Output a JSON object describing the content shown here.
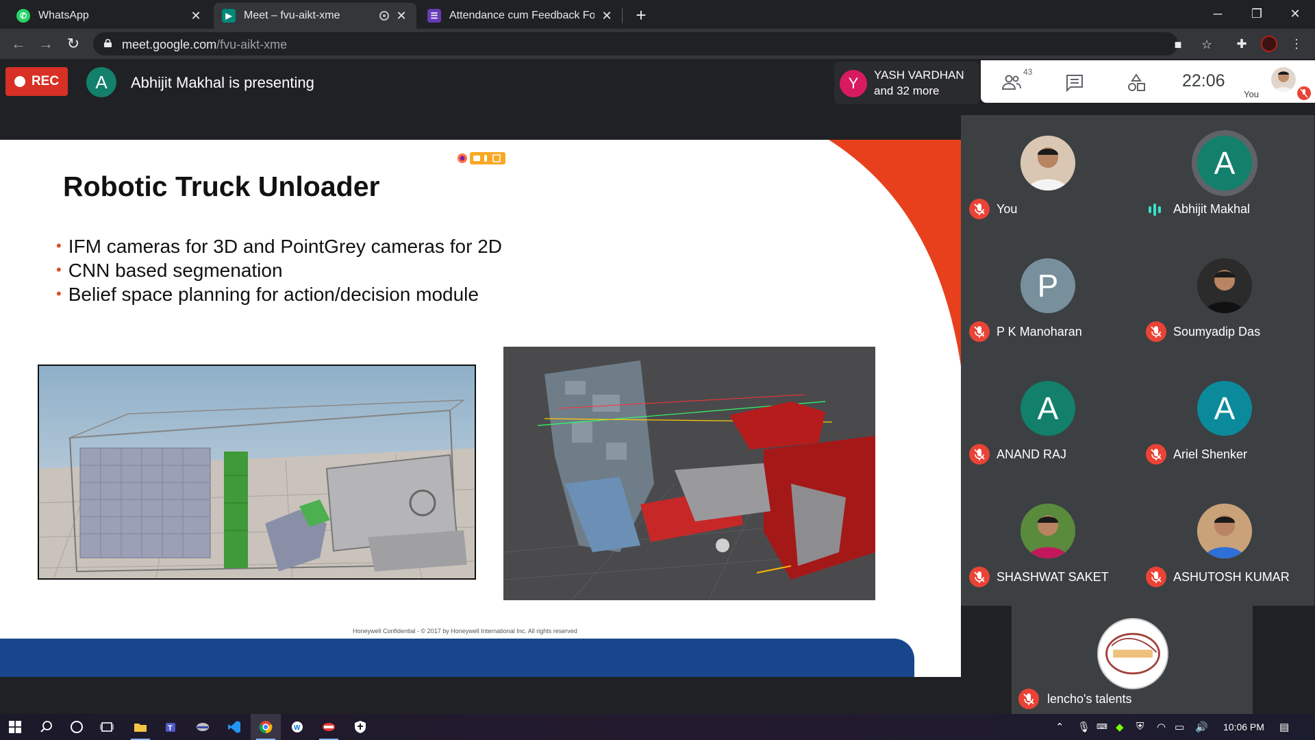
{
  "browser": {
    "tabs": [
      {
        "title": "WhatsApp",
        "icon": "whatsapp-icon",
        "color": "#25d366"
      },
      {
        "title": "Meet – fvu-aikt-xme",
        "icon": "google-meet-icon",
        "color": "#00897b"
      },
      {
        "title": "Attendance cum Feedback Form",
        "icon": "google-forms-icon",
        "color": "#673ab7"
      }
    ],
    "new_tab": "+",
    "url_host": "meet.google.com",
    "url_path": "/fvu-aikt-xme"
  },
  "meet": {
    "rec_label": "REC",
    "presenter_initial": "A",
    "presenting_text": "Abhijit Makhal is presenting",
    "join_initial": "Y",
    "join_name": "YASH VARDHAN",
    "join_more": "and 32 more",
    "participant_count": "43",
    "clock": "22:06",
    "you_label": "You"
  },
  "slide": {
    "title": "Robotic Truck Unloader",
    "bullets": [
      "IFM cameras for 3D and PointGrey cameras for 2D",
      "CNN based segmenation",
      "Belief space planning for action/decision module"
    ],
    "footer": "Honeywell Confidential - © 2017 by Honeywell International Inc. All rights reserved",
    "accent_color": "#e8401c",
    "footer_color": "#17468c"
  },
  "participants": [
    {
      "name": "You",
      "initial": "",
      "color": "#d9c7b3",
      "muted": true
    },
    {
      "name": "Abhijit Makhal",
      "initial": "A",
      "color": "#12806b",
      "muted": false,
      "speaking": true
    },
    {
      "name": "P K Manoharan",
      "initial": "P",
      "color": "#78909c",
      "muted": true
    },
    {
      "name": "Soumyadip Das",
      "initial": "",
      "color": "#2b2b2b",
      "muted": true
    },
    {
      "name": "ANAND RAJ",
      "initial": "A",
      "color": "#12806b",
      "muted": true
    },
    {
      "name": "Ariel Shenker",
      "initial": "A",
      "color": "#0b8a9c",
      "muted": true
    },
    {
      "name": "SHASHWAT SAKET",
      "initial": "",
      "color": "#5a8a3c",
      "muted": true
    },
    {
      "name": "ASHUTOSH KUMAR",
      "initial": "",
      "color": "#c9a27a",
      "muted": true
    },
    {
      "name": "lencho's talents",
      "initial": "",
      "color": "#ffffff",
      "muted": true
    }
  ],
  "taskbar": {
    "time": "10:06 PM"
  }
}
